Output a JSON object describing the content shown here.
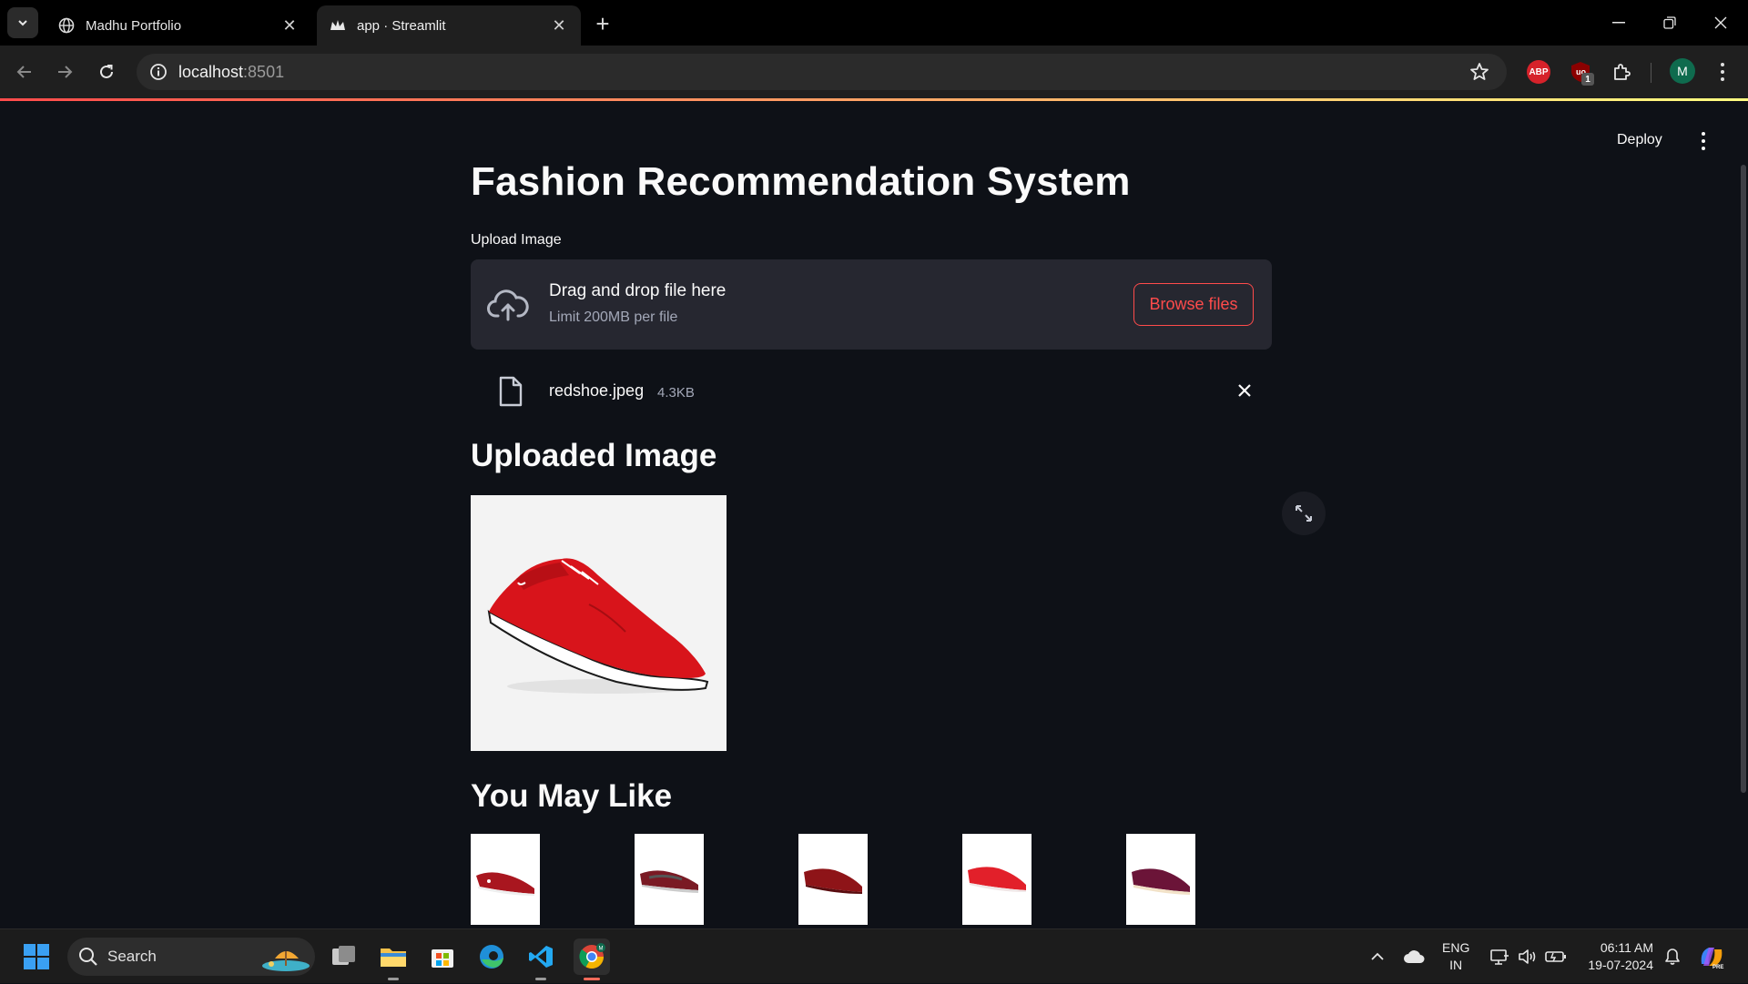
{
  "browser": {
    "tabs": [
      {
        "title": "Madhu Portfolio",
        "favicon": "globe-icon",
        "active": false
      },
      {
        "title": "app · Streamlit",
        "favicon": "streamlit-crown-icon",
        "active": true
      }
    ],
    "url_host": "localhost",
    "url_port": ":8501",
    "extensions": [
      {
        "name": "adblock-plus-icon",
        "label": "ABP",
        "color": "#d6222a"
      },
      {
        "name": "ublock-icon",
        "badge": "1",
        "color": "#8b0000"
      }
    ],
    "profile_initial": "M"
  },
  "app": {
    "toolbar": {
      "deploy_label": "Deploy"
    },
    "title": "Fashion Recommendation System",
    "uploader": {
      "label": "Upload Image",
      "drop_text": "Drag and drop file here",
      "limit_text": "Limit 200MB per file",
      "browse_label": "Browse files"
    },
    "file": {
      "name": "redshoe.jpeg",
      "size": "4.3KB"
    },
    "uploaded_header": "Uploaded Image",
    "recommend_header": "You May Like",
    "accent_color": "#ff4b4b",
    "recommendations": [
      {
        "kind": "red-loafer"
      },
      {
        "kind": "grey-slip-on"
      },
      {
        "kind": "maroon-loafer"
      },
      {
        "kind": "red-loafer-bright"
      },
      {
        "kind": "wine-loafer"
      }
    ]
  },
  "taskbar": {
    "search_label": "Search",
    "apps": [
      "task-view-icon",
      "file-explorer-icon",
      "microsoft-store-icon",
      "edge-icon",
      "vscode-icon",
      "chrome-icon"
    ],
    "lang_line1": "ENG",
    "lang_line2": "IN",
    "time": "06:11 AM",
    "date": "19-07-2024"
  }
}
